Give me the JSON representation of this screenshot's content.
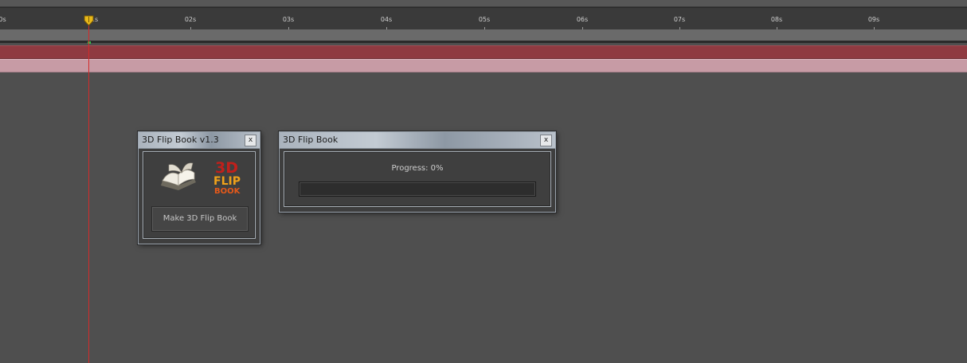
{
  "timeline": {
    "ruler_labels": [
      "0s",
      "01s",
      "02s",
      "03s",
      "04s",
      "05s",
      "06s",
      "07s",
      "08s",
      "09s"
    ],
    "colors": {
      "layer_red": "#8f3a41",
      "layer_pink": "#c79ba5",
      "playhead": "#d42a2a"
    }
  },
  "dialog_main": {
    "title": "3D Flip Book v1.3",
    "close_label": "x",
    "logo": {
      "line1": "3D",
      "line2": "FLIP",
      "line3": "BOOK",
      "icon": "open-book-icon"
    },
    "button_label": "Make 3D Flip Book"
  },
  "dialog_progress": {
    "title": "3D Flip Book",
    "close_label": "x",
    "progress_text": "Progress: 0%",
    "progress_value": 0
  }
}
